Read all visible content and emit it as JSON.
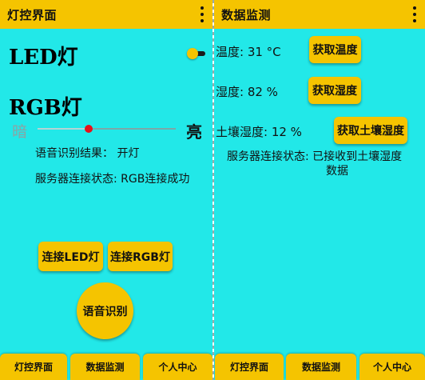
{
  "left": {
    "app_title": "灯控界面",
    "led_label": "LED灯",
    "led_switch_on": true,
    "rgb_label": "RGB灯",
    "slider_dark": "暗",
    "slider_bright": "亮",
    "brightness_fraction": 0.37,
    "voice_result": "语音识别结果：  开灯",
    "server_status": "服务器连接状态:   RGB连接成功",
    "connect_led_button": "连接LED灯",
    "connect_rgb_button": "连接RGB灯",
    "voice_button": "语音识别",
    "tabs": [
      "灯控界面",
      "数据监测",
      "个人中心"
    ]
  },
  "right": {
    "app_title": "数据监测",
    "temp_text": "温度:  31 °C",
    "temp_button": "获取温度",
    "humidity_text": "湿度:  82  %",
    "humidity_button": "获取湿度",
    "soil_text": "土壤湿度:  12  %",
    "soil_button": "获取土壤湿度",
    "server_status_line1": "服务器连接状态:   已接收到土壤湿度",
    "server_status_line2": "数据",
    "tabs": [
      "灯控界面",
      "数据监测",
      "个人中心"
    ]
  },
  "colors": {
    "background": "#22e8e8",
    "accent": "#f5c400",
    "slider_thumb": "#e8101a"
  },
  "icons": {
    "menu": "more-vert-icon"
  }
}
